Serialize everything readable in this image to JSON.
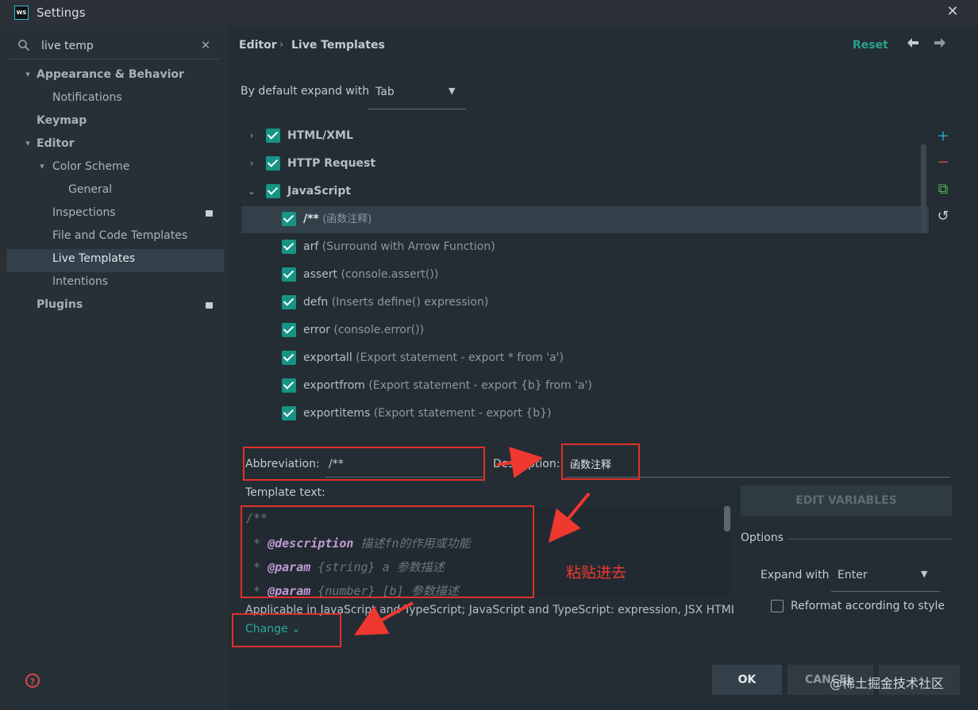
{
  "window": {
    "title": "Settings",
    "logo_text": "WS",
    "close": "✕"
  },
  "search": {
    "value": "live temp",
    "clear": "✕",
    "icon": "🔍︎"
  },
  "sidebar": {
    "items": [
      {
        "label": "Appearance & Behavior",
        "arrow": "⌄"
      },
      {
        "label": "Notifications"
      },
      {
        "label": "Keymap"
      },
      {
        "label": "Editor",
        "arrow": "⌄"
      },
      {
        "label": "Color Scheme",
        "arrow": "⌄"
      },
      {
        "label": "General"
      },
      {
        "label": "Inspections"
      },
      {
        "label": "File and Code Templates"
      },
      {
        "label": "Live Templates"
      },
      {
        "label": "Intentions"
      },
      {
        "label": "Plugins"
      }
    ],
    "help": "?"
  },
  "header": {
    "breadcrumb": [
      "Editor",
      "›",
      "Live Templates"
    ],
    "reset": "Reset",
    "back": "🡐",
    "forward": "🡒"
  },
  "expand_default": {
    "label": "By default expand with",
    "value": "Tab"
  },
  "template_groups": [
    {
      "label": "HTML/XML",
      "expanded": false
    },
    {
      "label": "HTTP Request",
      "expanded": false
    },
    {
      "label": "JavaScript",
      "expanded": true
    }
  ],
  "templates": [
    {
      "abbr": "/**",
      "desc": "(函数注释)"
    },
    {
      "abbr": "arf",
      "desc": "(Surround with Arrow Function)"
    },
    {
      "abbr": "assert",
      "desc": "(console.assert())"
    },
    {
      "abbr": "defn",
      "desc": "(Inserts define() expression)"
    },
    {
      "abbr": "error",
      "desc": "(console.error())"
    },
    {
      "abbr": "exportall",
      "desc": "(Export statement - export * from 'a')"
    },
    {
      "abbr": "exportfrom",
      "desc": "(Export statement - export {b} from 'a')"
    },
    {
      "abbr": "exportitems",
      "desc": "(Export statement - export {b})"
    }
  ],
  "toolbar": {
    "add": "+",
    "remove": "−",
    "copy": "⧉",
    "restore": "↺"
  },
  "editor": {
    "abbreviation_label": "Abbreviation:",
    "abbreviation_value": "/**",
    "description_label": "Description:",
    "description_value": "函数注释",
    "template_text_label": "Template text:",
    "code": [
      {
        "prefix": "/**",
        "kw": "",
        "rest": ""
      },
      {
        "prefix": " * ",
        "kw": "@description",
        "rest": " 描述fn的作用或功能"
      },
      {
        "prefix": " * ",
        "kw": "@param",
        "rest": " {string} a 参数描述"
      },
      {
        "prefix": " * ",
        "kw": "@param",
        "rest": " {number} [b] 参数描述"
      }
    ],
    "applicable": "Applicable in JavaScript and TypeScript; JavaScript and TypeScript: expression, JSX HTML, ...",
    "change": "Change ⌄",
    "edit_variables": "EDIT VARIABLES",
    "options_label": "Options",
    "expand_with_label": "Expand with",
    "expand_with_value": "Enter",
    "reformat_label": "Reformat according to style"
  },
  "footer": {
    "ok": "OK",
    "cancel": "CANCEL"
  },
  "annotation": {
    "text": "粘贴进去"
  },
  "watermark": "@稀土掘金技术社区",
  "colors": {
    "accent": "#169486",
    "annotation": "#e0302a",
    "link": "#28a99a"
  }
}
